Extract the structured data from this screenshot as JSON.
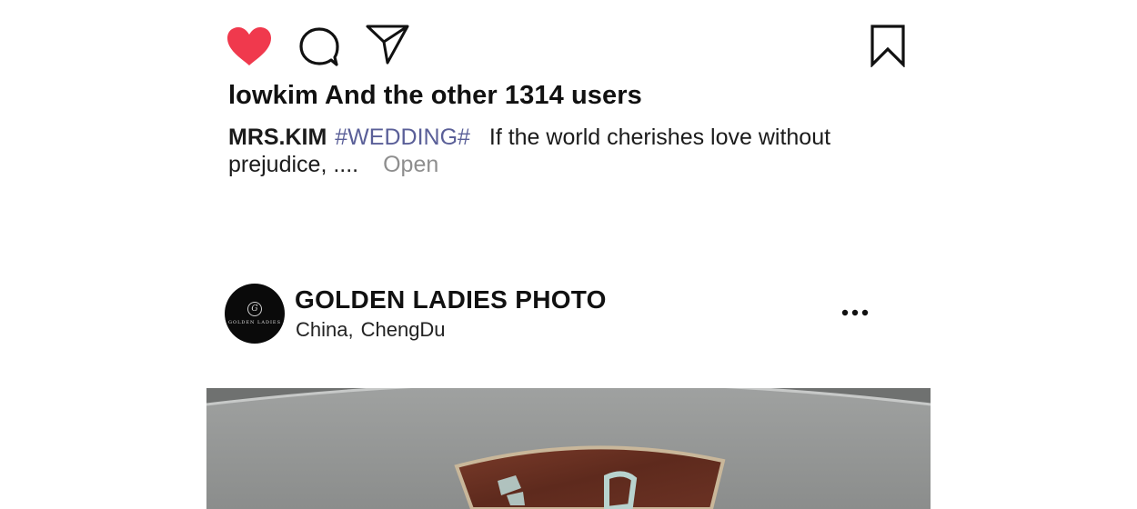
{
  "actions": {
    "like_icon": "heart-filled-icon",
    "comment_icon": "comment-bubble-icon",
    "share_icon": "paper-plane-icon",
    "bookmark_icon": "bookmark-icon",
    "like_color": "#f0394d"
  },
  "likes": {
    "text": "lowkim And the other 1314 users"
  },
  "caption": {
    "author": "MRS.KIM",
    "hashtag": "#WEDDING#",
    "text": "If the world cherishes love without prejudice, ....",
    "open_label": "Open",
    "hashtag_color": "#5a5f98"
  },
  "post_header": {
    "account_name": "GOLDEN LADIES PHOTO",
    "location_country": "China,",
    "location_city": "ChengDu",
    "avatar_logo_text": "GOLDEN LADIES",
    "more_icon": "more-horizontal-icon"
  },
  "post_image": {
    "description_icon": "photo"
  }
}
